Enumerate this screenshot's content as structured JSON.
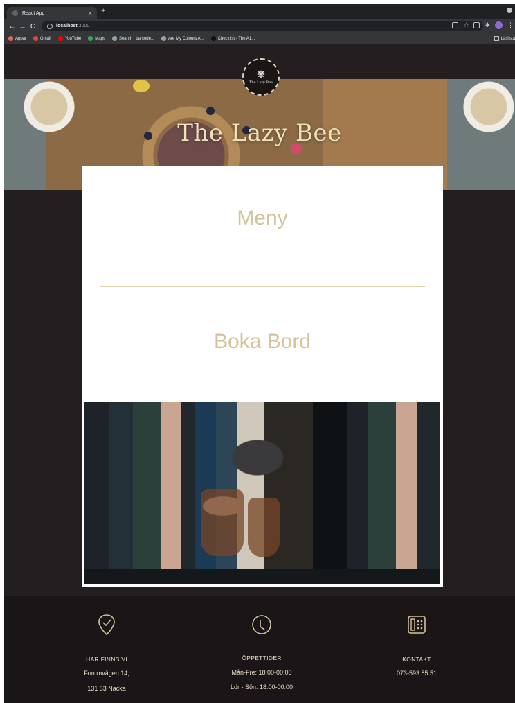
{
  "browser": {
    "tab_title": "React App",
    "tab_close": "×",
    "new_tab": "+",
    "nav": {
      "back": "←",
      "forward": "→",
      "reload": "C"
    },
    "url_host": "localhost",
    "url_port": ":3000",
    "bookmarks": [
      {
        "label": "Appar",
        "color": "#e26b4a"
      },
      {
        "label": "Gmail",
        "color": "#ea4335"
      },
      {
        "label": "YouTube",
        "color": "#ff0000"
      },
      {
        "label": "Maps",
        "color": "#34a853"
      },
      {
        "label": "Search · barcode...",
        "color": "#9aa0a6"
      },
      {
        "label": "Are My Colours A...",
        "color": "#9aa0a6"
      },
      {
        "label": "Checklist - The A1...",
        "color": "#111111"
      }
    ],
    "reading_list": "Läslista"
  },
  "site": {
    "logo_text": "The Lazy Bee",
    "hero_title": "The Lazy Bee",
    "menu_label": "Meny",
    "book_label": "Boka Bord"
  },
  "footer": {
    "location": {
      "heading": "HÄR FINNS VI",
      "line1": "Forumvägen 14,",
      "line2": "131 53 Nacka"
    },
    "hours": {
      "heading": "ÖPPETTIDER",
      "line1": "Mån-Fre: 18:00-00:00",
      "line2": "Lör - Sön: 18:00-00:00"
    },
    "contact": {
      "heading": "KONTAKT",
      "line1": "073-593 85 51"
    }
  },
  "colors": {
    "accent_gold": "#d4c39b",
    "page_dark": "#231f20",
    "footer_dark": "#1a1617"
  }
}
